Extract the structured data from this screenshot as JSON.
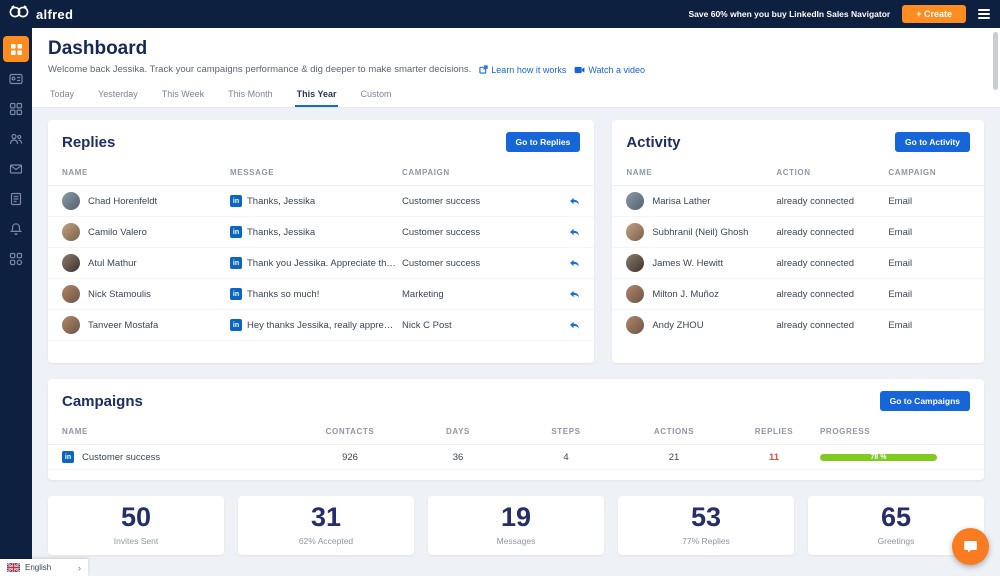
{
  "topbar": {
    "brand": "alfred",
    "promo": "Save 60% when you buy LinkedIn Sales Navigator",
    "create_label": "+ Create"
  },
  "sidebar": {
    "icons": [
      "dashboard",
      "prospects",
      "campaigns",
      "contacts",
      "inbox",
      "templates",
      "notifications",
      "integrations"
    ]
  },
  "header": {
    "title": "Dashboard",
    "subtitle": "Welcome back Jessika. Track your campaigns performance & dig deeper to make smarter decisions.",
    "links": [
      {
        "label": "Learn how it works"
      },
      {
        "label": "Watch a video"
      }
    ]
  },
  "tabs": {
    "items": [
      "Today",
      "Yesterday",
      "This Week",
      "This Month",
      "This Year",
      "Custom"
    ],
    "active": "This Year"
  },
  "replies": {
    "title": "Replies",
    "button": "Go to Replies",
    "columns": [
      "NAME",
      "MESSAGE",
      "CAMPAIGN"
    ],
    "linkedin_badge": "in",
    "rows": [
      {
        "name": "Chad Horenfeldt",
        "message": "Thanks, Jessika",
        "campaign": "Customer success"
      },
      {
        "name": "Camilo Valero",
        "message": "Thanks, Jessika",
        "campaign": "Customer success"
      },
      {
        "name": "Atul Mathur",
        "message": "Thank you Jessika. Appreciate the w...",
        "campaign": "Customer success"
      },
      {
        "name": "Nick Stamoulis",
        "message": "Thanks so much!",
        "campaign": "Marketing"
      },
      {
        "name": "Tanveer Mostafa",
        "message": "Hey thanks Jessika, really appreciat...",
        "campaign": "Nick C Post"
      }
    ]
  },
  "activity": {
    "title": "Activity",
    "button": "Go to Activity",
    "columns": [
      "NAME",
      "ACTION",
      "CAMPAIGN"
    ],
    "rows": [
      {
        "name": "Marisa Lather",
        "action": "already connected",
        "campaign": "Email"
      },
      {
        "name": "Subhranil (Neil) Ghosh",
        "action": "already connected",
        "campaign": "Email"
      },
      {
        "name": "James W. Hewitt",
        "action": "already connected",
        "campaign": "Email"
      },
      {
        "name": "Milton J. Muñoz",
        "action": "already connected",
        "campaign": "Email"
      },
      {
        "name": "Andy ZHOU",
        "action": "already connected",
        "campaign": "Email"
      }
    ]
  },
  "campaigns": {
    "title": "Campaigns",
    "button": "Go to Campaigns",
    "columns": [
      "NAME",
      "CONTACTS",
      "DAYS",
      "STEPS",
      "ACTIONS",
      "REPLIES",
      "PROGRESS"
    ],
    "rows": [
      {
        "name": "Customer success",
        "contacts": "926",
        "days": "36",
        "steps": "4",
        "actions": "21",
        "replies": "11",
        "progress_label": "78 %",
        "progress_pct": 78
      }
    ]
  },
  "stats": [
    {
      "value": "50",
      "label": "Invites Sent"
    },
    {
      "value": "31",
      "label": "62% Accepted"
    },
    {
      "value": "19",
      "label": "Messages"
    },
    {
      "value": "53",
      "label": "77% Replies"
    },
    {
      "value": "65",
      "label": "Greetings"
    }
  ],
  "language": {
    "label": "English"
  },
  "colors": {
    "navy": "#0e2040",
    "accent_orange": "#ff8c21",
    "accent_blue": "#1665d9",
    "green_progress": "#7fcb20",
    "replies_red": "#e74c3c"
  }
}
